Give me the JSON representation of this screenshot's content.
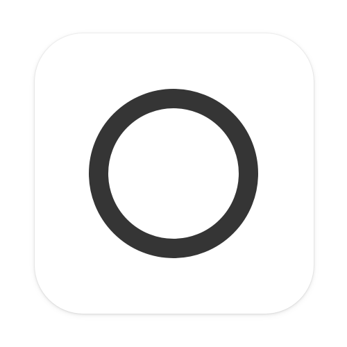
{
  "icon": {
    "name": "circle-ring-icon",
    "ring_color": "#353535",
    "tile_color": "#ffffff",
    "page_color": "#ffffff"
  }
}
